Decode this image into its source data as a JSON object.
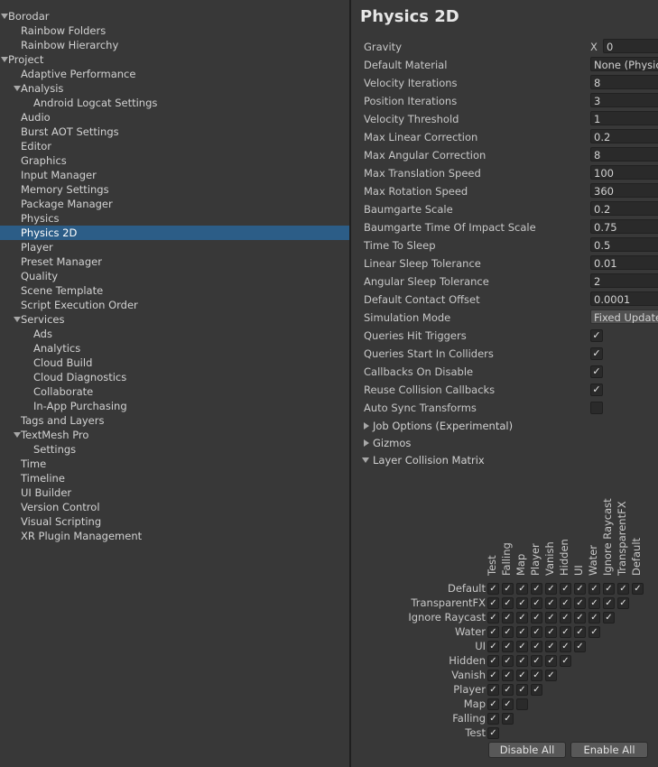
{
  "sidebar": {
    "items": [
      {
        "label": "Borodar",
        "level": 0,
        "foldout": true
      },
      {
        "label": "Rainbow Folders",
        "level": 1
      },
      {
        "label": "Rainbow Hierarchy",
        "level": 1
      },
      {
        "label": "Project",
        "level": 0,
        "foldout": true
      },
      {
        "label": "Adaptive Performance",
        "level": 1
      },
      {
        "label": "Analysis",
        "level": 1,
        "foldout": true
      },
      {
        "label": "Android Logcat Settings",
        "level": 2
      },
      {
        "label": "Audio",
        "level": 1
      },
      {
        "label": "Burst AOT Settings",
        "level": 1
      },
      {
        "label": "Editor",
        "level": 1
      },
      {
        "label": "Graphics",
        "level": 1
      },
      {
        "label": "Input Manager",
        "level": 1
      },
      {
        "label": "Memory Settings",
        "level": 1
      },
      {
        "label": "Package Manager",
        "level": 1
      },
      {
        "label": "Physics",
        "level": 1
      },
      {
        "label": "Physics 2D",
        "level": 1,
        "selected": true
      },
      {
        "label": "Player",
        "level": 1
      },
      {
        "label": "Preset Manager",
        "level": 1
      },
      {
        "label": "Quality",
        "level": 1
      },
      {
        "label": "Scene Template",
        "level": 1
      },
      {
        "label": "Script Execution Order",
        "level": 1
      },
      {
        "label": "Services",
        "level": 1,
        "foldout": true
      },
      {
        "label": "Ads",
        "level": 2
      },
      {
        "label": "Analytics",
        "level": 2
      },
      {
        "label": "Cloud Build",
        "level": 2
      },
      {
        "label": "Cloud Diagnostics",
        "level": 2
      },
      {
        "label": "Collaborate",
        "level": 2
      },
      {
        "label": "In-App Purchasing",
        "level": 2
      },
      {
        "label": "Tags and Layers",
        "level": 1
      },
      {
        "label": "TextMesh Pro",
        "level": 1,
        "foldout": true
      },
      {
        "label": "Settings",
        "level": 2
      },
      {
        "label": "Time",
        "level": 1
      },
      {
        "label": "Timeline",
        "level": 1
      },
      {
        "label": "UI Builder",
        "level": 1
      },
      {
        "label": "Version Control",
        "level": 1
      },
      {
        "label": "Visual Scripting",
        "level": 1
      },
      {
        "label": "XR Plugin Management",
        "level": 1
      }
    ]
  },
  "panel": {
    "title": "Physics 2D",
    "gravity": {
      "label": "Gravity",
      "x_label": "X",
      "x_value": "0"
    },
    "default_material": {
      "label": "Default Material",
      "value": "None (Physics"
    },
    "fields": [
      {
        "label": "Velocity Iterations",
        "value": "8"
      },
      {
        "label": "Position Iterations",
        "value": "3"
      },
      {
        "label": "Velocity Threshold",
        "value": "1"
      },
      {
        "label": "Max Linear Correction",
        "value": "0.2"
      },
      {
        "label": "Max Angular Correction",
        "value": "8"
      },
      {
        "label": "Max Translation Speed",
        "value": "100"
      },
      {
        "label": "Max Rotation Speed",
        "value": "360"
      },
      {
        "label": "Baumgarte Scale",
        "value": "0.2"
      },
      {
        "label": "Baumgarte Time Of Impact Scale",
        "value": "0.75"
      },
      {
        "label": "Time To Sleep",
        "value": "0.5"
      },
      {
        "label": "Linear Sleep Tolerance",
        "value": "0.01"
      },
      {
        "label": "Angular Sleep Tolerance",
        "value": "2"
      },
      {
        "label": "Default Contact Offset",
        "value": "0.0001"
      }
    ],
    "simulation_mode": {
      "label": "Simulation Mode",
      "value": "Fixed Update"
    },
    "toggles": [
      {
        "label": "Queries Hit Triggers",
        "checked": true
      },
      {
        "label": "Queries Start In Colliders",
        "checked": true
      },
      {
        "label": "Callbacks On Disable",
        "checked": true
      },
      {
        "label": "Reuse Collision Callbacks",
        "checked": true
      },
      {
        "label": "Auto Sync Transforms",
        "checked": false
      }
    ],
    "foldouts": [
      {
        "label": "Job Options (Experimental)",
        "expanded": false
      },
      {
        "label": "Gizmos",
        "expanded": false
      },
      {
        "label": "Layer Collision Matrix",
        "expanded": true
      }
    ],
    "matrix": {
      "layers": [
        "Default",
        "TransparentFX",
        "Ignore Raycast",
        "Water",
        "UI",
        "Hidden",
        "Vanish",
        "Player",
        "Map",
        "Falling",
        "Test"
      ],
      "unchecked": [
        [
          "Map",
          "Map"
        ]
      ],
      "disable_all_label": "Disable All",
      "enable_all_label": "Enable All"
    }
  }
}
